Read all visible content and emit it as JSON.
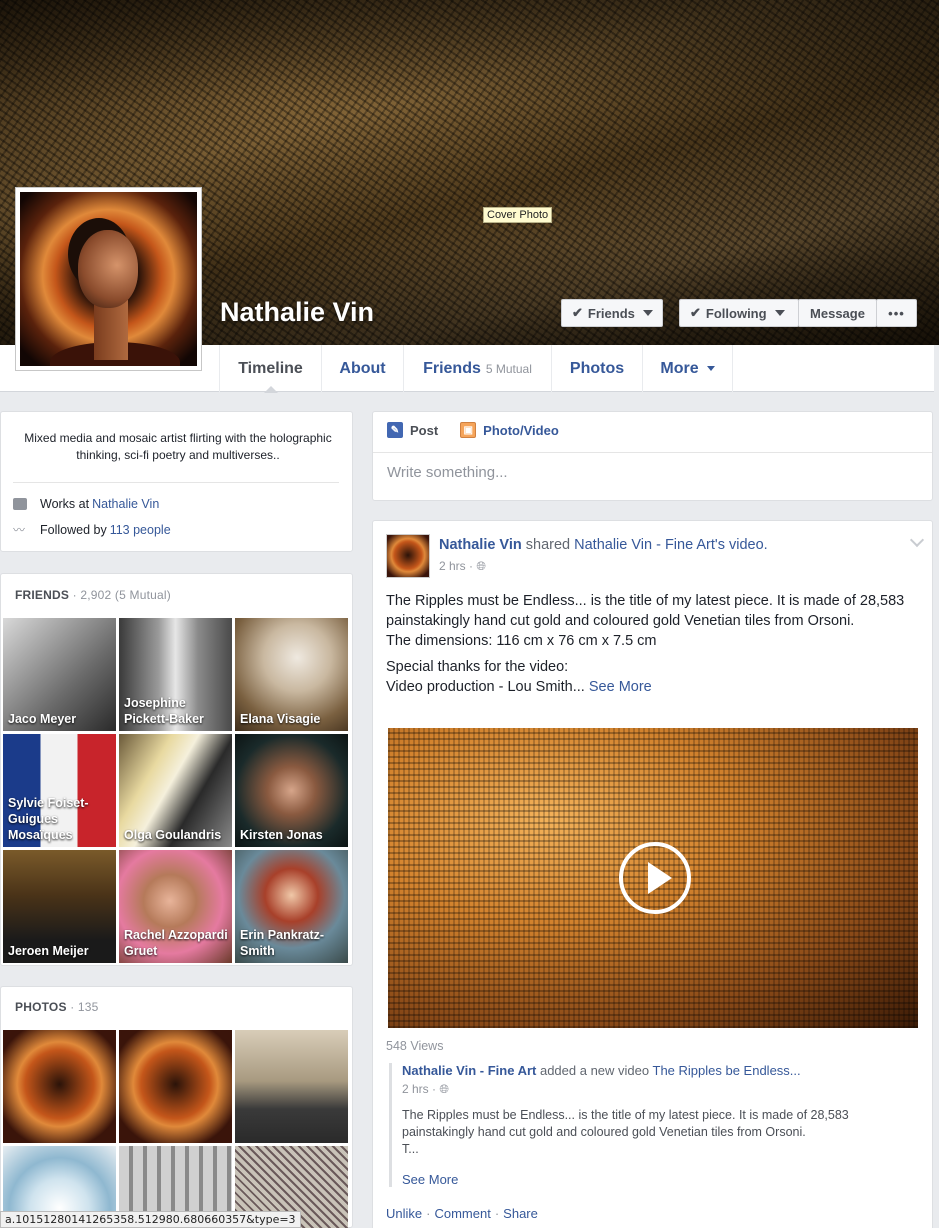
{
  "cover": {
    "tooltip": "Cover Photo"
  },
  "profile": {
    "name": "Nathalie Vin",
    "buttons": {
      "friends": "Friends",
      "following": "Following",
      "message": "Message",
      "more": "•••"
    }
  },
  "tabs": [
    {
      "label": "Timeline"
    },
    {
      "label": "About"
    },
    {
      "label": "Friends",
      "sub": "5 Mutual"
    },
    {
      "label": "Photos"
    },
    {
      "label": "More"
    }
  ],
  "intro": {
    "bio": "Mixed media and mosaic artist flirting with the holographic thinking, sci-fi poetry and multiverses..",
    "works_prefix": "Works at ",
    "works_link": "Nathalie Vin",
    "followed_prefix": "Followed by ",
    "followed_link": "113 people"
  },
  "friends": {
    "title": "FRIENDS",
    "count": " · 2,902 (5 Mutual)",
    "items": [
      {
        "name": "Jaco Meyer"
      },
      {
        "name": "Josephine Pickett-Baker"
      },
      {
        "name": "Elana Visagie"
      },
      {
        "name": "Sylvie Foiset-Guigues Mosaïques"
      },
      {
        "name": "Olga Goulandris"
      },
      {
        "name": "Kirsten Jonas"
      },
      {
        "name": "Jeroen Meijer"
      },
      {
        "name": "Rachel Azzopardi Gruet"
      },
      {
        "name": "Erin Pankratz-Smith"
      }
    ]
  },
  "photos": {
    "title": "PHOTOS",
    "count": " · 135"
  },
  "composer": {
    "post": "Post",
    "photo_video": "Photo/Video",
    "placeholder": "Write something..."
  },
  "post": {
    "author": "Nathalie Vin",
    "verb": " shared ",
    "page": "Nathalie Vin - Fine Art",
    "suffix": "'s video.",
    "time": "2 hrs ·",
    "line1": "The Ripples must be Endless... is the title of my latest piece. It is made of 28,583 painstakingly hand cut gold and coloured gold Venetian tiles from Orsoni.",
    "line2": "The dimensions: 116 cm x 76 cm x 7.5 cm",
    "line3": "Special thanks for the video:",
    "line4": "Video production - Lou Smith... ",
    "see_more": "See More",
    "views": "548 Views",
    "shared": {
      "page": "Nathalie Vin - Fine Art",
      "verb": " added a new video ",
      "video": "The Ripples be Endless...",
      "time": "2 hrs ·",
      "text": "The Ripples must be Endless... is the title of my latest piece. It is made of 28,583 painstakingly hand cut gold and coloured gold Venetian tiles from Orsoni.",
      "text2": "T...",
      "see_more": "See More"
    },
    "actions": {
      "unlike": "Unlike",
      "comment": "Comment",
      "share": "Share"
    }
  },
  "status_url": "a.10151280141265358.512980.680660357&type=3"
}
